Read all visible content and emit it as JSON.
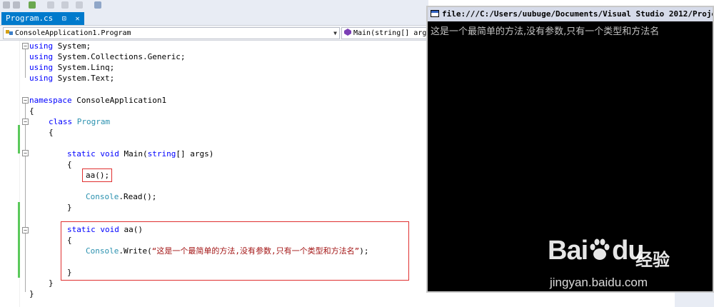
{
  "ide": {
    "tab": {
      "label": "Program.cs",
      "pin": "⊡",
      "close": "✕"
    },
    "nav": {
      "class_combo": "ConsoleApplication1.Program",
      "method_combo": "Main(string[] args"
    },
    "code": {
      "l1_kw": "using",
      "l1_rest": " System;",
      "l2_kw": "using",
      "l2_rest": " System.Collections.Generic;",
      "l3_kw": "using",
      "l3_rest": " System.Linq;",
      "l4_kw": "using",
      "l4_rest": " System.Text;",
      "l5_kw": "namespace",
      "l5_rest": " ConsoleApplication1",
      "brace_open": "{",
      "brace_close": "}",
      "class_kw": "class",
      "class_name": "Program",
      "main_static": "static",
      "main_void": "void",
      "main_name": " Main(",
      "main_string": "string",
      "main_rest": "[] args)",
      "call_aa": "aa();",
      "console": "Console",
      "read": ".Read();",
      "aa_static": "static",
      "aa_void": "void",
      "aa_name": " aa()",
      "write": ".Write(",
      "write_str": "“这是一个最简单的方法,没有参数,只有一个类型和方法名”",
      "write_end": ");"
    }
  },
  "console": {
    "title": "file:///C:/Users/uubuge/Documents/Visual Studio 2012/Proje",
    "output": "这是一个最简单的方法,没有参数,只有一个类型和方法名"
  },
  "watermark": {
    "text": "Bai",
    "du": "du",
    "cn": "经验",
    "url": "jingyan.baidu.com"
  },
  "colors": {
    "keyword": "#0000ff",
    "type": "#2b91af",
    "string": "#a31515",
    "highlight_box": "#e03030",
    "change_bar": "#5bc95b",
    "tab_active": "#007acc"
  }
}
